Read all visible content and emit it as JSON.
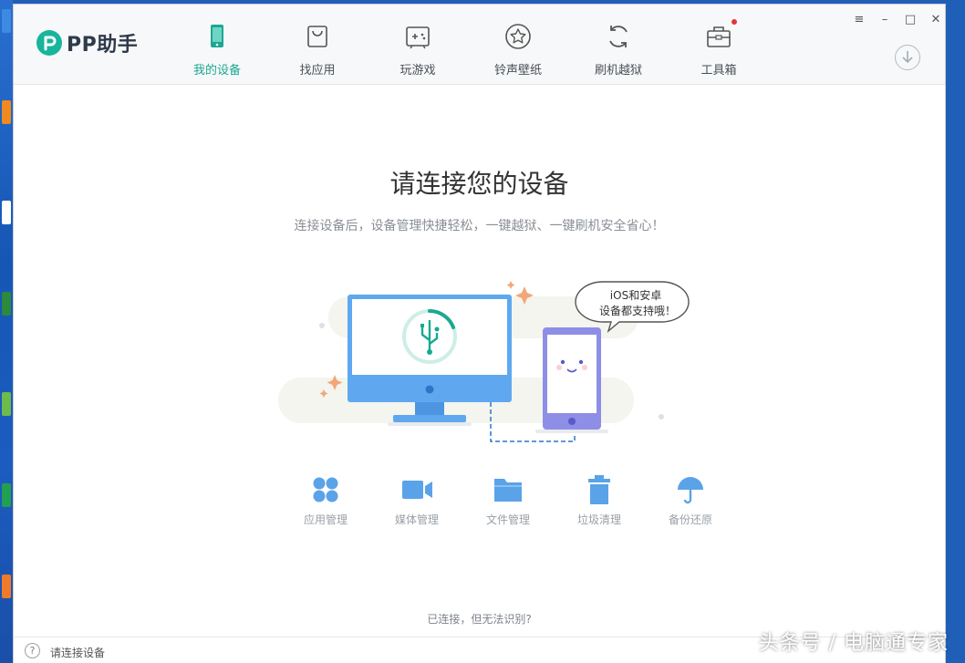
{
  "app": {
    "name": "PP助手"
  },
  "nav": {
    "items": [
      {
        "label": "我的设备",
        "icon": "phone-icon"
      },
      {
        "label": "找应用",
        "icon": "bag-icon"
      },
      {
        "label": "玩游戏",
        "icon": "gamepad-icon"
      },
      {
        "label": "铃声壁纸",
        "icon": "star-icon"
      },
      {
        "label": "刷机越狱",
        "icon": "refresh-icon"
      },
      {
        "label": "工具箱",
        "icon": "toolbox-icon"
      }
    ],
    "active_index": 0
  },
  "window_controls": {
    "menu": "≡",
    "minimize": "–",
    "maximize": "□",
    "close": "✕"
  },
  "main": {
    "title": "请连接您的设备",
    "subtitle": "连接设备后，设备管理快捷轻松，一键越狱、一键刷机安全省心！",
    "bubble_line1": "iOS和安卓",
    "bubble_line2": "设备都支持哦！",
    "features": [
      {
        "label": "应用管理",
        "icon": "apps-icon"
      },
      {
        "label": "媒体管理",
        "icon": "video-camera-icon"
      },
      {
        "label": "文件管理",
        "icon": "folder-icon"
      },
      {
        "label": "垃圾清理",
        "icon": "trash-icon"
      },
      {
        "label": "备份还原",
        "icon": "umbrella-icon"
      }
    ],
    "help_link": "已连接，但无法识别?"
  },
  "status": {
    "help_glyph": "?",
    "text": "请连接设备"
  },
  "watermark": "头条号 / 电脑通专家",
  "colors": {
    "accent": "#1ba892",
    "feature_blue": "#5aa3e8",
    "monitor_blue": "#5fa8f0",
    "phone_purple": "#8e8ee6"
  }
}
